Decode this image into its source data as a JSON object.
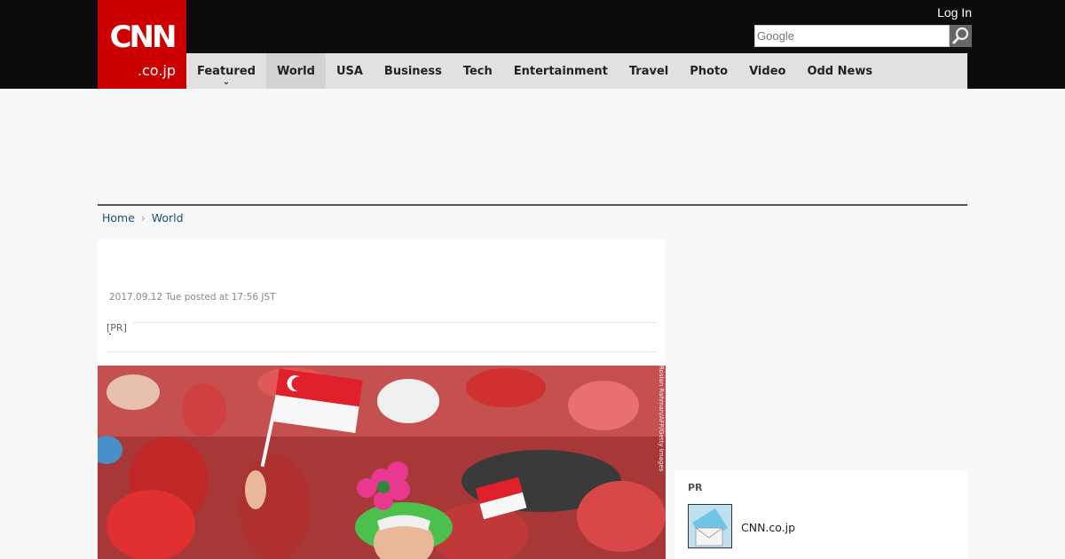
{
  "header": {
    "logo_text": "CNN",
    "logo_sub": ".co.jp",
    "login_label": "Log In",
    "search_placeholder": "Google"
  },
  "nav": {
    "items": [
      {
        "label": "Featured"
      },
      {
        "label": "World"
      },
      {
        "label": "USA"
      },
      {
        "label": "Business"
      },
      {
        "label": "Tech"
      },
      {
        "label": "Entertainment"
      },
      {
        "label": "Travel"
      },
      {
        "label": "Photo"
      },
      {
        "label": "Video"
      },
      {
        "label": "Odd News"
      }
    ]
  },
  "breadcrumb": {
    "home": "Home",
    "current": "World"
  },
  "article": {
    "dateline": "2017.09.12 Tue posted at 17:56 JST",
    "pr_label": "[PR]",
    "photo_credit": "Roslan Rahman/AFP/Getty Images"
  },
  "sidebar": {
    "pr_title": "PR",
    "pr_link": "CNN.co.jp"
  },
  "colors": {
    "brand_red": "#cc0000",
    "topbar": "#0c0c0c",
    "nav_bg": "#e1e1e1",
    "link": "#1a4f7a"
  }
}
